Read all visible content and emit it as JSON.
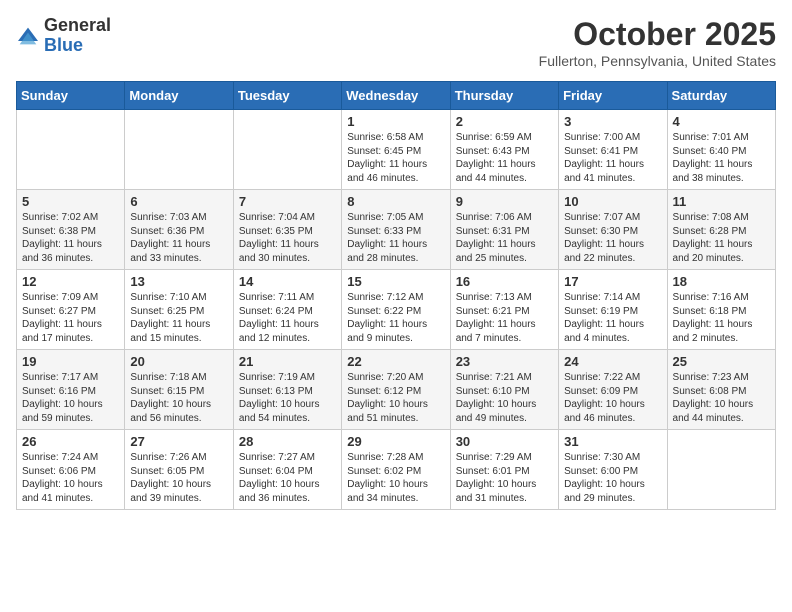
{
  "logo": {
    "general": "General",
    "blue": "Blue"
  },
  "title": "October 2025",
  "location": "Fullerton, Pennsylvania, United States",
  "days_header": [
    "Sunday",
    "Monday",
    "Tuesday",
    "Wednesday",
    "Thursday",
    "Friday",
    "Saturday"
  ],
  "weeks": [
    [
      {
        "day": "",
        "info": ""
      },
      {
        "day": "",
        "info": ""
      },
      {
        "day": "",
        "info": ""
      },
      {
        "day": "1",
        "info": "Sunrise: 6:58 AM\nSunset: 6:45 PM\nDaylight: 11 hours\nand 46 minutes."
      },
      {
        "day": "2",
        "info": "Sunrise: 6:59 AM\nSunset: 6:43 PM\nDaylight: 11 hours\nand 44 minutes."
      },
      {
        "day": "3",
        "info": "Sunrise: 7:00 AM\nSunset: 6:41 PM\nDaylight: 11 hours\nand 41 minutes."
      },
      {
        "day": "4",
        "info": "Sunrise: 7:01 AM\nSunset: 6:40 PM\nDaylight: 11 hours\nand 38 minutes."
      }
    ],
    [
      {
        "day": "5",
        "info": "Sunrise: 7:02 AM\nSunset: 6:38 PM\nDaylight: 11 hours\nand 36 minutes."
      },
      {
        "day": "6",
        "info": "Sunrise: 7:03 AM\nSunset: 6:36 PM\nDaylight: 11 hours\nand 33 minutes."
      },
      {
        "day": "7",
        "info": "Sunrise: 7:04 AM\nSunset: 6:35 PM\nDaylight: 11 hours\nand 30 minutes."
      },
      {
        "day": "8",
        "info": "Sunrise: 7:05 AM\nSunset: 6:33 PM\nDaylight: 11 hours\nand 28 minutes."
      },
      {
        "day": "9",
        "info": "Sunrise: 7:06 AM\nSunset: 6:31 PM\nDaylight: 11 hours\nand 25 minutes."
      },
      {
        "day": "10",
        "info": "Sunrise: 7:07 AM\nSunset: 6:30 PM\nDaylight: 11 hours\nand 22 minutes."
      },
      {
        "day": "11",
        "info": "Sunrise: 7:08 AM\nSunset: 6:28 PM\nDaylight: 11 hours\nand 20 minutes."
      }
    ],
    [
      {
        "day": "12",
        "info": "Sunrise: 7:09 AM\nSunset: 6:27 PM\nDaylight: 11 hours\nand 17 minutes."
      },
      {
        "day": "13",
        "info": "Sunrise: 7:10 AM\nSunset: 6:25 PM\nDaylight: 11 hours\nand 15 minutes."
      },
      {
        "day": "14",
        "info": "Sunrise: 7:11 AM\nSunset: 6:24 PM\nDaylight: 11 hours\nand 12 minutes."
      },
      {
        "day": "15",
        "info": "Sunrise: 7:12 AM\nSunset: 6:22 PM\nDaylight: 11 hours\nand 9 minutes."
      },
      {
        "day": "16",
        "info": "Sunrise: 7:13 AM\nSunset: 6:21 PM\nDaylight: 11 hours\nand 7 minutes."
      },
      {
        "day": "17",
        "info": "Sunrise: 7:14 AM\nSunset: 6:19 PM\nDaylight: 11 hours\nand 4 minutes."
      },
      {
        "day": "18",
        "info": "Sunrise: 7:16 AM\nSunset: 6:18 PM\nDaylight: 11 hours\nand 2 minutes."
      }
    ],
    [
      {
        "day": "19",
        "info": "Sunrise: 7:17 AM\nSunset: 6:16 PM\nDaylight: 10 hours\nand 59 minutes."
      },
      {
        "day": "20",
        "info": "Sunrise: 7:18 AM\nSunset: 6:15 PM\nDaylight: 10 hours\nand 56 minutes."
      },
      {
        "day": "21",
        "info": "Sunrise: 7:19 AM\nSunset: 6:13 PM\nDaylight: 10 hours\nand 54 minutes."
      },
      {
        "day": "22",
        "info": "Sunrise: 7:20 AM\nSunset: 6:12 PM\nDaylight: 10 hours\nand 51 minutes."
      },
      {
        "day": "23",
        "info": "Sunrise: 7:21 AM\nSunset: 6:10 PM\nDaylight: 10 hours\nand 49 minutes."
      },
      {
        "day": "24",
        "info": "Sunrise: 7:22 AM\nSunset: 6:09 PM\nDaylight: 10 hours\nand 46 minutes."
      },
      {
        "day": "25",
        "info": "Sunrise: 7:23 AM\nSunset: 6:08 PM\nDaylight: 10 hours\nand 44 minutes."
      }
    ],
    [
      {
        "day": "26",
        "info": "Sunrise: 7:24 AM\nSunset: 6:06 PM\nDaylight: 10 hours\nand 41 minutes."
      },
      {
        "day": "27",
        "info": "Sunrise: 7:26 AM\nSunset: 6:05 PM\nDaylight: 10 hours\nand 39 minutes."
      },
      {
        "day": "28",
        "info": "Sunrise: 7:27 AM\nSunset: 6:04 PM\nDaylight: 10 hours\nand 36 minutes."
      },
      {
        "day": "29",
        "info": "Sunrise: 7:28 AM\nSunset: 6:02 PM\nDaylight: 10 hours\nand 34 minutes."
      },
      {
        "day": "30",
        "info": "Sunrise: 7:29 AM\nSunset: 6:01 PM\nDaylight: 10 hours\nand 31 minutes."
      },
      {
        "day": "31",
        "info": "Sunrise: 7:30 AM\nSunset: 6:00 PM\nDaylight: 10 hours\nand 29 minutes."
      },
      {
        "day": "",
        "info": ""
      }
    ]
  ]
}
